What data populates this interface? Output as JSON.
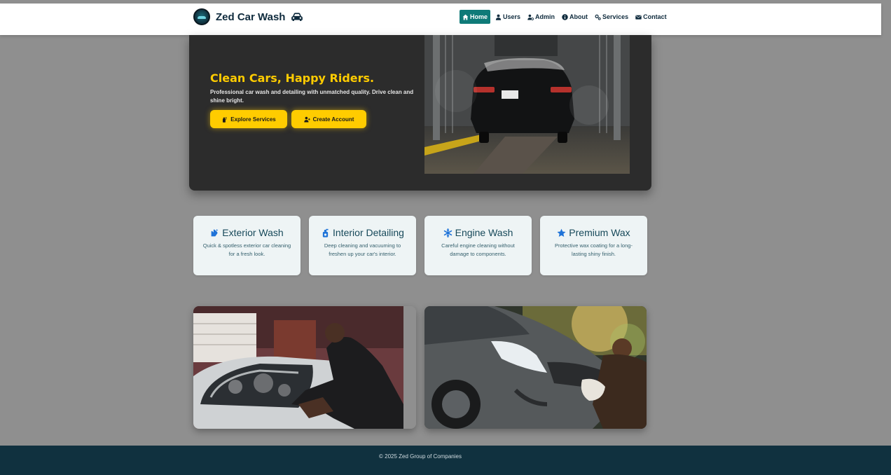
{
  "colors": {
    "page_bg": "#8f8f8f",
    "navbar_bg": "#ffffff",
    "brand_text": "#0f2b3d",
    "nav_active_bg": "#0f7a78",
    "hero_bg": "#2c2c2c",
    "accent_yellow": "#ffcc00",
    "card_bg": "#eef4f5",
    "card_icon_blue": "#1f73d8",
    "footer_bg": "#10313f"
  },
  "navbar": {
    "brand_name": "Zed Car Wash",
    "brand_icon": "car-icon",
    "items": [
      {
        "label": "Home",
        "icon": "home-icon",
        "active": true
      },
      {
        "label": "Users",
        "icon": "user-icon",
        "active": false
      },
      {
        "label": "Admin",
        "icon": "user-gear-icon",
        "active": false
      },
      {
        "label": "About",
        "icon": "info-circle-icon",
        "active": false
      },
      {
        "label": "Services",
        "icon": "gears-icon",
        "active": false
      },
      {
        "label": "Contact",
        "icon": "envelope-icon",
        "active": false
      }
    ]
  },
  "hero": {
    "title": "Clean Cars, Happy Riders.",
    "description": "Professional car wash and detailing with unmatched quality. Drive clean and shine bright.",
    "buttons": [
      {
        "label": "Explore Services",
        "icon": "spray-bottle-icon"
      },
      {
        "label": "Create Account",
        "icon": "user-plus-icon"
      }
    ]
  },
  "services": [
    {
      "title": "Exterior Wash",
      "icon": "hand-sparkles-icon",
      "description": "Quick & spotless exterior car cleaning for a fresh look."
    },
    {
      "title": "Interior Detailing",
      "icon": "pump-soap-icon",
      "description": "Deep cleaning and vacuuming to freshen up your car's interior."
    },
    {
      "title": "Engine Wash",
      "icon": "snowflake-icon",
      "description": "Careful engine cleaning without damage to components."
    },
    {
      "title": "Premium Wax",
      "icon": "star-icon",
      "description": "Protective wax coating for a long-lasting shiny finish."
    }
  ],
  "footer": {
    "copyright": "© 2025 Zed Group of Companies"
  }
}
